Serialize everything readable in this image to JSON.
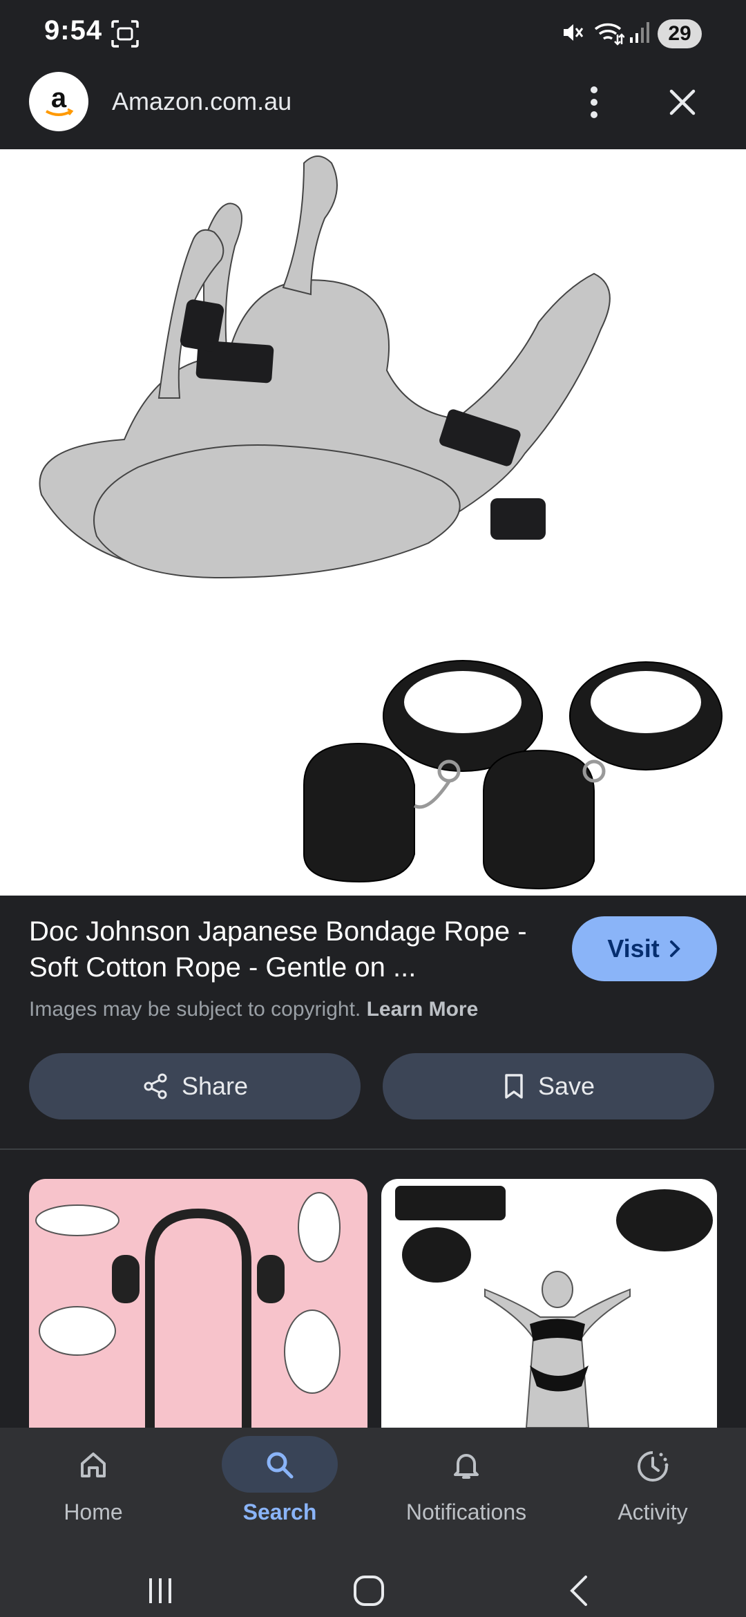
{
  "status_bar": {
    "time": "9:54",
    "battery": "29",
    "icons": [
      "screenshot-icon",
      "mute-icon",
      "wifi-icon",
      "signal-icon"
    ]
  },
  "header": {
    "site_logo_letter": "a",
    "site_name": "Amazon.com.au",
    "icons": [
      "more-vert-icon",
      "close-icon"
    ]
  },
  "result": {
    "title": "Doc Johnson Japanese Bondage Rope - Soft Cotton Rope - Gentle on ...",
    "visit_label": "Visit",
    "copyright_text": "Images may be subject to copyright.",
    "learn_more_label": "Learn More"
  },
  "actions": {
    "share_label": "Share",
    "save_label": "Save"
  },
  "bottom_nav": {
    "items": [
      {
        "label": "Home",
        "icon": "home-icon"
      },
      {
        "label": "Search",
        "icon": "search-icon",
        "active": true
      },
      {
        "label": "Notifications",
        "icon": "bell-icon"
      },
      {
        "label": "Activity",
        "icon": "activity-icon"
      }
    ]
  },
  "colors": {
    "background": "#202124",
    "accent": "#8ab4f8",
    "action_button": "#3c4556"
  }
}
